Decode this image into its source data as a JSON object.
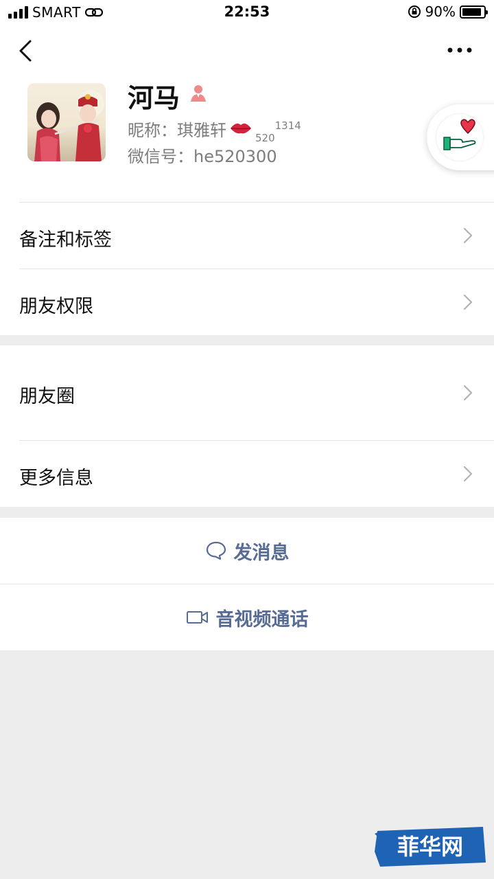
{
  "status_bar": {
    "carrier": "SMART",
    "time": "22:53",
    "battery": "90%",
    "battery_level": 0.9
  },
  "profile": {
    "name": "河马",
    "nickname_prefix": "昵称：",
    "nickname": "琪雅轩",
    "nickname_sub": "520",
    "nickname_sup": "1314",
    "wechat_id_prefix": "微信号：",
    "wechat_id": "he520300"
  },
  "menu": {
    "remarks_tags": "备注和标签",
    "friend_permissions": "朋友权限",
    "moments": "朋友圈",
    "more_info": "更多信息"
  },
  "actions": {
    "send_message": "发消息",
    "video_call": "音视频通话"
  },
  "watermark": "菲华网",
  "colors": {
    "link_blue": "#576b95",
    "background_gray": "#ededed",
    "heart_red": "#e8334a"
  }
}
